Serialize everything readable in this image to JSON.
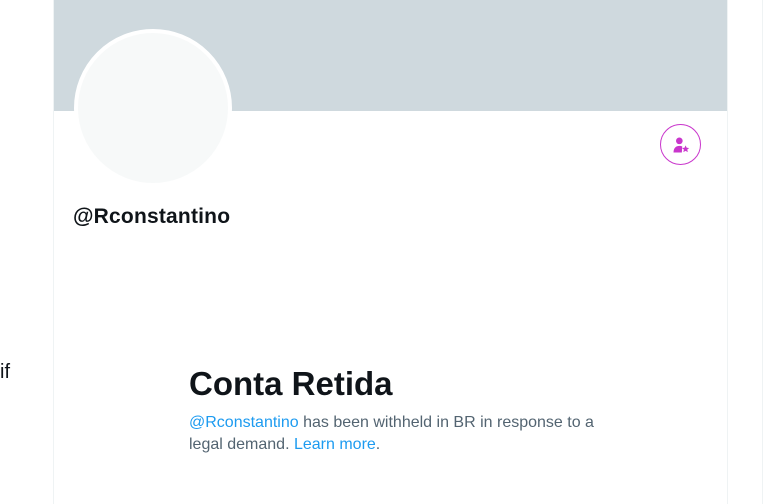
{
  "left_column": {
    "partial_text": "if"
  },
  "profile": {
    "handle": "@Rconstantino",
    "banner_color": "#cfd9de",
    "avatar_color": "#f7f9f9"
  },
  "subscribe_button": {
    "icon": "person-star-icon",
    "accent_color": "#c936cc"
  },
  "withheld": {
    "title": "Conta Retida",
    "handle_link": "@Rconstantino",
    "message": " has been withheld in BR in response to a legal demand. ",
    "learn_more": "Learn more",
    "period": ".",
    "link_color": "#1d9bf0"
  }
}
